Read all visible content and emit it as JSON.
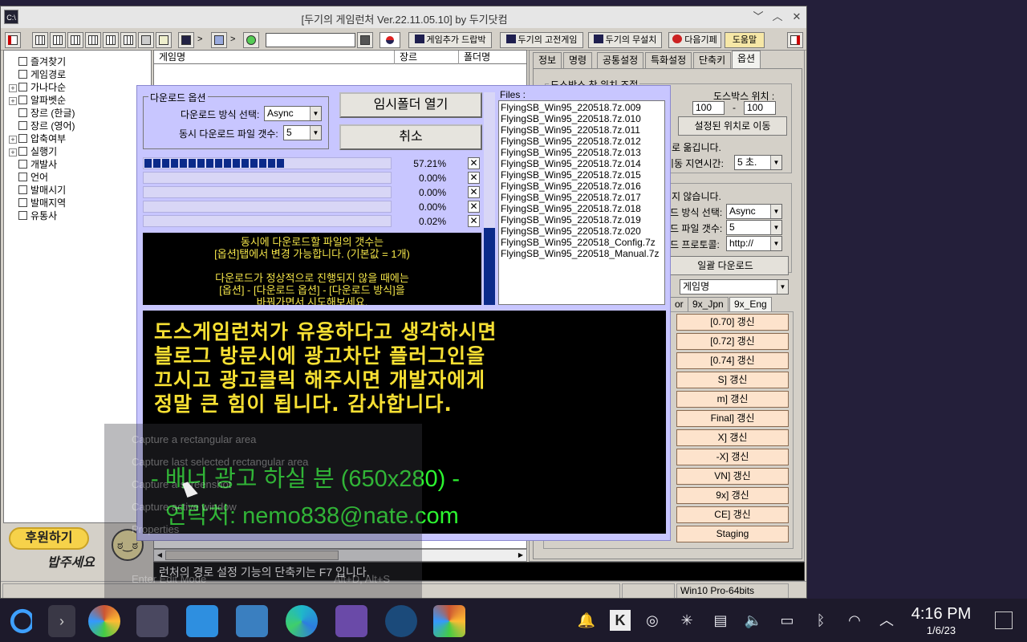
{
  "window": {
    "title": "[두기의 게임런처 Ver.22.11.05.10] by 두기닷컴",
    "app_icon": "C:\\"
  },
  "toolbar": {
    "search_value": "",
    "btn_game_add": "게임추가 드랍박스",
    "btn_fixed": "두기의 고전게임",
    "btn_free": "두기의 무설치",
    "btn_next": "다음기페",
    "btn_help": "도움말",
    "sep": ">"
  },
  "tree": [
    {
      "label": "즐겨찾기",
      "expand": false
    },
    {
      "label": "게임경로",
      "expand": false
    },
    {
      "label": "가나다순",
      "expand": true
    },
    {
      "label": "알파벳순",
      "expand": true
    },
    {
      "label": "장르 (한글)",
      "expand": false
    },
    {
      "label": "장르 (영어)",
      "expand": false
    },
    {
      "label": "압축여부",
      "expand": true
    },
    {
      "label": "실행기",
      "expand": true
    },
    {
      "label": "개발사",
      "expand": false
    },
    {
      "label": "언어",
      "expand": false
    },
    {
      "label": "발매시기",
      "expand": false
    },
    {
      "label": "발매지역",
      "expand": false
    },
    {
      "label": "유통사",
      "expand": false
    }
  ],
  "donate": {
    "button": "후원하기",
    "note": "밥주세요"
  },
  "game_list": {
    "columns": [
      "게임명",
      "장르",
      "폴더명"
    ]
  },
  "right_panel": {
    "tabs": [
      "정보",
      "명령",
      "공통설정",
      "특화설정",
      "단축키",
      "옵션"
    ],
    "dosbox_group": "도스박스 창 위치 조절",
    "dosbox_pos_label": "도스박스 위치 :",
    "pos_x": "100",
    "pos_sep": "-",
    "pos_y": "100",
    "move_btn": "설정된 위치로 이동",
    "move_note": "로 옮깁니다.",
    "delay_label": "이동 지연시간:",
    "delay_value": "5 초.",
    "dl_note": "지 않습니다.",
    "method_label": "드 방식 선택:",
    "method_value": "Async",
    "count_label": "드 파일 갯수:",
    "count_value": "5",
    "protocol_label": "드 프로토콜:",
    "protocol_value": "http://",
    "batch_btn": "일괄 다운로드",
    "sort_value": "게임명",
    "subtabs": [
      "or",
      "9x_Jpn",
      "9x_Eng"
    ],
    "updates": [
      "[0.70] 갱신",
      "[0.72] 갱신",
      "[0.74] 갱신",
      "S] 갱신",
      "m] 갱신",
      "Final] 갱신",
      "X] 갱신",
      "-X] 갱신",
      "VN] 갱신",
      "9x] 갱신",
      "CE] 갱신",
      "Staging"
    ]
  },
  "status": {
    "message": "런처의 경로 설정 기능의 단축키는 F7 입니다.",
    "os": "Win10 Pro-64bits"
  },
  "download": {
    "options_title": "다운로드 옵션",
    "method_label": "다운로드 방식 선택:",
    "method_value": "Async",
    "count_label": "동시 다운로드 파일 갯수:",
    "count_value": "5",
    "open_temp": "임시폴더 열기",
    "cancel": "취소",
    "close_glyph": "✕",
    "progress": [
      {
        "pct_text": "57.21%",
        "value": 0.5721
      },
      {
        "pct_text": "0.00%",
        "value": 0
      },
      {
        "pct_text": "0.00%",
        "value": 0
      },
      {
        "pct_text": "0.00%",
        "value": 0
      },
      {
        "pct_text": "0.02%",
        "value": 0.0002
      }
    ],
    "info_lines": [
      "동시에 다운로드할 파일의 갯수는",
      "[옵션]탭에서 변경 가능합니다. (기본값 = 1개)",
      "",
      "다운로드가 정상적으로 진행되지 않을 때에는",
      "[옵션] - [다운로드 옵션] - [다운로드 방식]을",
      "바꿔가면서 시도해보세요."
    ],
    "files_label": "Files :",
    "files": [
      "FlyingSB_Win95_220518.7z.009",
      "FlyingSB_Win95_220518.7z.010",
      "FlyingSB_Win95_220518.7z.011",
      "FlyingSB_Win95_220518.7z.012",
      "FlyingSB_Win95_220518.7z.013",
      "FlyingSB_Win95_220518.7z.014",
      "FlyingSB_Win95_220518.7z.015",
      "FlyingSB_Win95_220518.7z.016",
      "FlyingSB_Win95_220518.7z.017",
      "FlyingSB_Win95_220518.7z.018",
      "FlyingSB_Win95_220518.7z.019",
      "FlyingSB_Win95_220518.7z.020",
      "FlyingSB_Win95_220518_Config.7z",
      "FlyingSB_Win95_220518_Manual.7z"
    ],
    "banner_lines": [
      "도스게임런처가 유용하다고 생각하시면",
      "블로그 방문시에 광고차단 플러그인을",
      "끄시고 광고클릭 해주시면 개발자에게",
      "정말 큰 힘이 됩니다. 감사합니다."
    ],
    "banner_ad1": "- 배너 광고 하실 분 (650x280) -",
    "banner_ad2": "연락처: nemo838@nate.com"
  },
  "context_menu": [
    {
      "label": "Capture a rectangular area",
      "shortcut": ""
    },
    {
      "label": "Capture last selected rectangular area",
      "shortcut": ""
    },
    {
      "label": "Capture a screenshot",
      "shortcut": ""
    },
    {
      "label": "Capture active window",
      "shortcut": ""
    },
    {
      "label": "Properties",
      "shortcut": ""
    },
    {
      "label": "Enter Edit Mode",
      "shortcut": "Alt+D, Alt+S"
    }
  ],
  "taskbar": {
    "time": "4:16 PM",
    "date": "1/6/23"
  },
  "colors": {
    "dialog_bg": "#c8c6ff",
    "progress_fill": "#0b2a8a",
    "banner_yellow": "#f7e033",
    "banner_green": "#2cf530"
  }
}
